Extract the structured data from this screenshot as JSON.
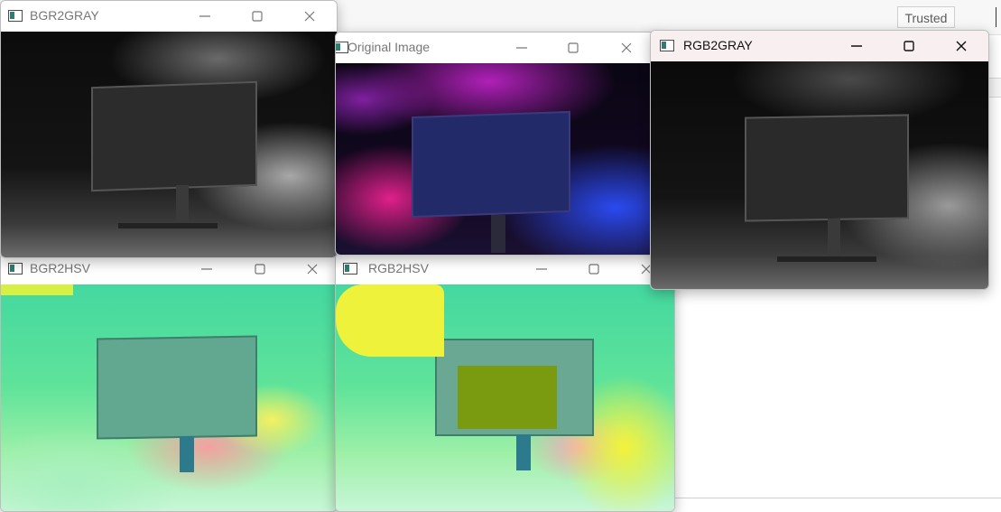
{
  "background": {
    "trusted_label": "Trusted"
  },
  "windows": [
    {
      "id": "bgr2gray",
      "title": "BGR2GRAY"
    },
    {
      "id": "original",
      "title": "Original Image"
    },
    {
      "id": "rgb2gray",
      "title": "RGB2GRAY"
    },
    {
      "id": "bgr2hsv",
      "title": "BGR2HSV"
    },
    {
      "id": "rgb2hsv",
      "title": "RGB2HSV"
    }
  ],
  "icons": {
    "window_icon": "opencv-window-icon",
    "minimize": "minimize-icon",
    "maximize": "maximize-icon",
    "close": "close-icon"
  },
  "colors": {
    "active_titlebar": "#f8f0f0",
    "hsv_green": "#5fe39a",
    "hsv_yellow": "#e8f04a",
    "original_magenta": "#d0208c",
    "original_blue": "#2040e0"
  }
}
